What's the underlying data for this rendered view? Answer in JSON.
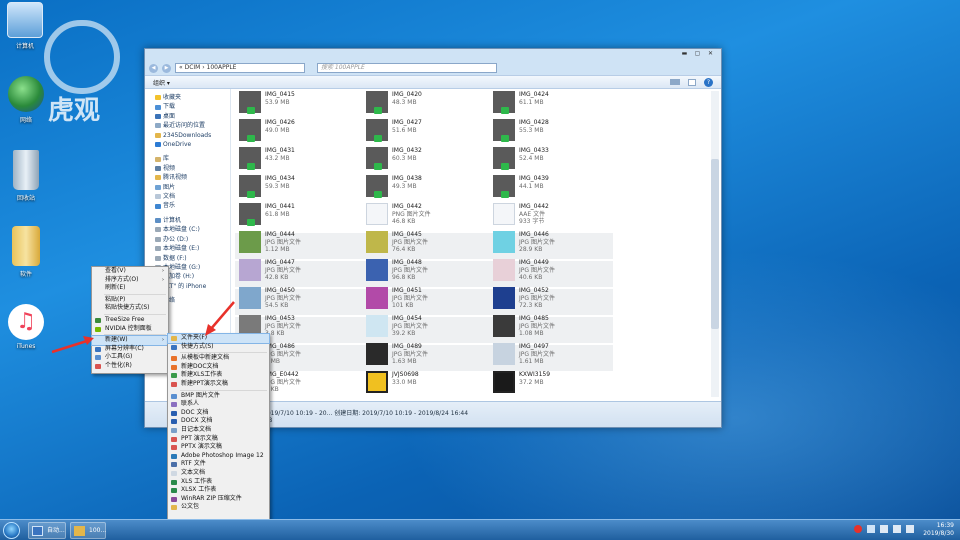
{
  "desktop": {
    "icons": [
      {
        "label": "计算机"
      },
      {
        "label": "网络"
      },
      {
        "label": "回收站"
      },
      {
        "label": "软件"
      },
      {
        "label": "iTunes"
      }
    ],
    "watermark_text": "虎观"
  },
  "explorer": {
    "breadcrumb": "« DCIM › 100APPLE",
    "search_placeholder": "搜索 100APPLE",
    "organize_label": "组织 ▾",
    "nav": {
      "favorites": [
        "收藏夹",
        "下载",
        "桌面",
        "最近访问的位置",
        "2345Downloads",
        "OneDrive"
      ],
      "libraries": [
        "库",
        "视频",
        "腾讯视频",
        "图片",
        "文档",
        "音乐"
      ],
      "computer": [
        "计算机",
        "本地磁盘 (C:)",
        "办公 (D:)",
        "本地磁盘 (E:)",
        "数据 (F:)",
        "本地磁盘 (G:)",
        "新加卷 (H:)",
        "\"XT\" 的 iPhone"
      ],
      "network": "网络"
    },
    "files": [
      {
        "name": "IMG_0415",
        "meta1": "53.9 MB",
        "meta2": ""
      },
      {
        "name": "IMG_0420",
        "meta1": "48.3 MB",
        "meta2": ""
      },
      {
        "name": "IMG_0424",
        "meta1": "61.1 MB",
        "meta2": ""
      },
      {
        "name": "IMG_0426",
        "meta1": "49.0 MB",
        "meta2": ""
      },
      {
        "name": "IMG_0427",
        "meta1": "51.6 MB",
        "meta2": ""
      },
      {
        "name": "IMG_0428",
        "meta1": "55.3 MB",
        "meta2": ""
      },
      {
        "name": "IMG_0431",
        "meta1": "43.2 MB",
        "meta2": ""
      },
      {
        "name": "IMG_0432",
        "meta1": "60.3 MB",
        "meta2": ""
      },
      {
        "name": "IMG_0433",
        "meta1": "52.4 MB",
        "meta2": ""
      },
      {
        "name": "IMG_0434",
        "meta1": "59.3 MB",
        "meta2": ""
      },
      {
        "name": "IMG_0438",
        "meta1": "49.3 MB",
        "meta2": ""
      },
      {
        "name": "IMG_0439",
        "meta1": "44.1 MB",
        "meta2": ""
      },
      {
        "name": "IMG_0441",
        "meta1": "61.8 MB",
        "meta2": ""
      },
      {
        "name": "IMG_0442",
        "meta1": "PNG 图片文件",
        "meta2": "46.8 KB"
      },
      {
        "name": "IMG_0442",
        "meta1": "AAE 文件",
        "meta2": "933 字节"
      },
      {
        "name": "IMG_0444",
        "meta1": "JPG 图片文件",
        "meta2": "1.12 MB"
      },
      {
        "name": "IMG_0445",
        "meta1": "JPG 图片文件",
        "meta2": "76.4 KB"
      },
      {
        "name": "IMG_0446",
        "meta1": "JPG 图片文件",
        "meta2": "28.9 KB"
      },
      {
        "name": "IMG_0447",
        "meta1": "JPG 图片文件",
        "meta2": "42.8 KB"
      },
      {
        "name": "IMG_0448",
        "meta1": "JPG 图片文件",
        "meta2": "96.8 KB"
      },
      {
        "name": "IMG_0449",
        "meta1": "JPG 图片文件",
        "meta2": "40.6 KB"
      },
      {
        "name": "IMG_0450",
        "meta1": "JPG 图片文件",
        "meta2": "54.5 KB"
      },
      {
        "name": "IMG_0451",
        "meta1": "JPG 图片文件",
        "meta2": "101 KB"
      },
      {
        "name": "IMG_0452",
        "meta1": "JPG 图片文件",
        "meta2": "72.3 KB"
      },
      {
        "name": "IMG_0453",
        "meta1": "JPG 图片文件",
        "meta2": "3.8 KB"
      },
      {
        "name": "IMG_0454",
        "meta1": "JPG 图片文件",
        "meta2": "39.2 KB"
      },
      {
        "name": "IMG_0485",
        "meta1": "JPG 图片文件",
        "meta2": "1.08 MB"
      },
      {
        "name": "IMG_0486",
        "meta1": "JPG 图片文件",
        "meta2": "2 MB"
      },
      {
        "name": "IMG_0489",
        "meta1": "JPG 图片文件",
        "meta2": "1.63 MB"
      },
      {
        "name": "IMG_0497",
        "meta1": "JPG 图片文件",
        "meta2": "1.61 MB"
      },
      {
        "name": "IMG_E0442",
        "meta1": "JPG 图片文件",
        "meta2": "7 KB"
      },
      {
        "name": "JVJS0698",
        "meta1": "33.0 MB",
        "meta2": ""
      },
      {
        "name": "KXWI3159",
        "meta1": "37.2 MB",
        "meta2": ""
      }
    ],
    "details": "2019/7/10 10:19 - 20...   创建日期: 2019/7/10 10:19 - 2019/8/24 16:44",
    "details2": "MB"
  },
  "context_menu": {
    "items": [
      {
        "label": "查看(V)",
        "arrow": "›"
      },
      {
        "label": "排序方式(O)",
        "arrow": "›"
      },
      {
        "label": "刷新(E)",
        "arrow": ""
      },
      {
        "label": "粘贴(P)",
        "arrow": ""
      },
      {
        "label": "粘贴快捷方式(S)",
        "arrow": ""
      },
      {
        "label": "TreeSize Free",
        "arrow": ""
      },
      {
        "label": "NVIDIA 控制面板",
        "arrow": ""
      },
      {
        "label": "新建(W)",
        "arrow": "›"
      },
      {
        "label": "屏幕分辨率(C)",
        "arrow": ""
      },
      {
        "label": "小工具(G)",
        "arrow": ""
      },
      {
        "label": "个性化(R)",
        "arrow": ""
      }
    ]
  },
  "new_submenu": {
    "items": [
      "文件夹(F)",
      "快捷方式(S)",
      "从模板中新建文档",
      "新建DOC文档",
      "新建XLS工作表",
      "新建PPT演示文稿",
      "BMP 图片文件",
      "联系人",
      "DOC 文档",
      "DOCX 文档",
      "日记本文档",
      "PPT 演示文稿",
      "PPTX 演示文稿",
      "Adobe Photoshop Image 12",
      "RTF 文件",
      "文本文档",
      "XLS 工作表",
      "XLSX 工作表",
      "WinRAR ZIP 压缩文件",
      "公文包"
    ]
  },
  "taskbar": {
    "buttons": [
      "自动...",
      "100..."
    ],
    "time": "16:39",
    "date": "2019/8/30"
  },
  "colors": {
    "accent_red": "#e8312a",
    "check_green": "#2eb84b"
  }
}
